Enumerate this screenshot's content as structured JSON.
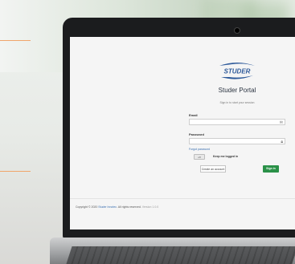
{
  "brand": {
    "logo_text": "STUDER",
    "accent_color": "#2e5a9a"
  },
  "login": {
    "title": "Studer Portal",
    "subtitle": "Sign in to start your session",
    "email_label": "Email",
    "email_icon": "mail-icon",
    "password_label": "Password",
    "password_icon": "lock-icon",
    "forgot_link": "Forgot password",
    "keep_toggle_state": "off",
    "keep_label": "Keep me logged in",
    "create_button": "Create an account",
    "signin_button": "Sign in",
    "signin_color": "#2a9148"
  },
  "footer": {
    "prefix": "Copyright © 2020 ",
    "company": "Studer Innotec",
    "suffix": ". All rights reserved.",
    "version": "Version 1.0.0"
  }
}
